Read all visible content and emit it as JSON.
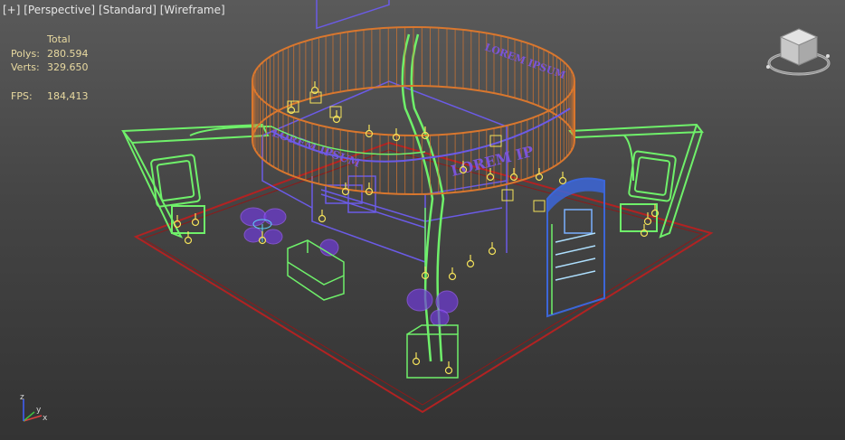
{
  "viewport": {
    "labels": [
      "[+]",
      "[Perspective]",
      "[Standard]",
      "[Wireframe]"
    ]
  },
  "stats": {
    "header": "Total",
    "polys_label": "Polys:",
    "polys_value": "280.594",
    "verts_label": "Verts:",
    "verts_value": "329.650",
    "fps_label": "FPS:",
    "fps_value": "184,413"
  },
  "scene": {
    "ring_text_front": "LOREM IP",
    "ring_text_left": "LOREM IPSUM",
    "ring_text_right": "LOREM IPSUM"
  },
  "axis": {
    "x": "x",
    "y": "y",
    "z": "z"
  },
  "colors": {
    "floor": "#b22222",
    "ring": "#d9772e",
    "truss": "#6ff06a",
    "structure": "#6b5be6",
    "lights": "#f4e25a",
    "panel_blue": "#3c66d8",
    "furniture": "#9b5cff"
  },
  "icons": {
    "viewcube": "viewcube-icon",
    "axis": "axis-tripod-icon"
  }
}
